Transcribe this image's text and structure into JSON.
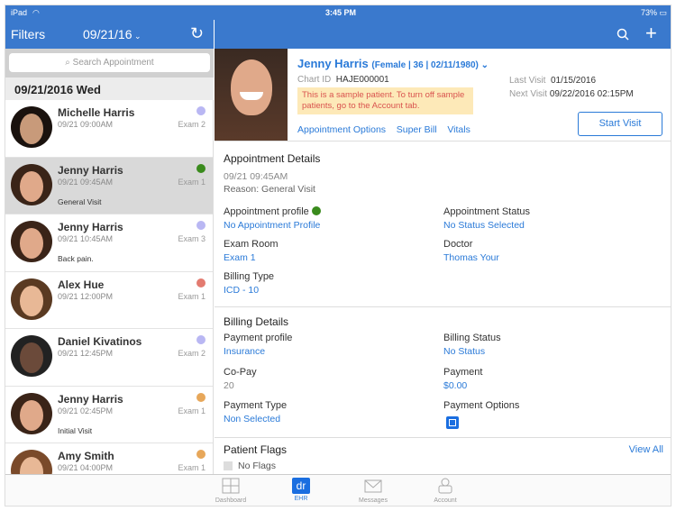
{
  "status": {
    "device": "iPad",
    "time": "3:45 PM",
    "battery": "73%"
  },
  "left_nav": {
    "filters": "Filters",
    "date": "09/21/16",
    "date_icon": "chevron-down-icon",
    "refresh_icon": "refresh-icon"
  },
  "right_nav": {
    "search_icon": "search-icon",
    "add_icon": "plus-icon"
  },
  "search": {
    "placeholder": "Search Appointment"
  },
  "day_header": "09/21/2016 Wed",
  "appointments": [
    {
      "name": "Michelle Harris",
      "time": "09/21 09:00AM",
      "room": "Exam 2",
      "reason": "",
      "color": "#b9b7f3"
    },
    {
      "name": "Jenny Harris",
      "time": "09/21 09:45AM",
      "room": "Exam 1",
      "reason": "General Visit",
      "color": "#3a8b1d",
      "selected": true
    },
    {
      "name": "Jenny Harris",
      "time": "09/21 10:45AM",
      "room": "Exam 3",
      "reason": "Back pain.",
      "color": "#b9b7f3"
    },
    {
      "name": "Alex Hue",
      "time": "09/21 12:00PM",
      "room": "Exam 1",
      "reason": "",
      "color": "#e37b70"
    },
    {
      "name": "Daniel Kivatinos",
      "time": "09/21 12:45PM",
      "room": "Exam 2",
      "reason": "",
      "color": "#b9b7f3"
    },
    {
      "name": "Jenny Harris",
      "time": "09/21 02:45PM",
      "room": "Exam 1",
      "reason": "Initial Visit",
      "color": "#e7a75a"
    },
    {
      "name": "Amy Smith",
      "time": "09/21 04:00PM",
      "room": "Exam 1",
      "reason": "",
      "color": "#e7a75a"
    }
  ],
  "patient": {
    "name": "Jenny Harris",
    "demographics": "(Female | 36 | 02/11/1980)",
    "chart_id_label": "Chart ID",
    "chart_id": "HAJE000001",
    "warning": "This is a sample patient. To turn off sample patients, go to the Account tab.",
    "last_visit_label": "Last Visit",
    "last_visit": "01/15/2016",
    "next_visit_label": "Next Visit",
    "next_visit": "09/22/2016 02:15PM",
    "links": [
      "Appointment Options",
      "Super Bill",
      "Vitals"
    ],
    "start_visit": "Start Visit"
  },
  "appointment_details": {
    "title": "Appointment Details",
    "datetime": "09/21 09:45AM",
    "reason": "Reason: General Visit",
    "profile_label": "Appointment profile",
    "profile_value": "No Appointment Profile",
    "profile_color": "#3a8b1d",
    "status_label": "Appointment Status",
    "status_value": "No Status Selected",
    "room_label": "Exam Room",
    "room_value": "Exam 1",
    "doctor_label": "Doctor",
    "doctor_value": "Thomas Your",
    "billing_type_label": "Billing Type",
    "billing_type_value": "ICD - 10"
  },
  "billing_details": {
    "title": "Billing Details",
    "payment_profile_label": "Payment profile",
    "payment_profile_value": "Insurance",
    "billing_status_label": "Billing Status",
    "billing_status_value": "No Status",
    "copay_label": "Co-Pay",
    "copay_value": "20",
    "payment_label": "Payment",
    "payment_value": "$0.00",
    "payment_type_label": "Payment Type",
    "payment_type_value": "Non Selected",
    "payment_options_label": "Payment Options",
    "payment_options_icon": "square-reader-icon"
  },
  "patient_flags": {
    "title": "Patient Flags",
    "view_all": "View All",
    "value": "No Flags"
  },
  "tabs": [
    {
      "label": "Dashboard"
    },
    {
      "label": "EHR",
      "active": true
    },
    {
      "label": "Messages"
    },
    {
      "label": "Account"
    }
  ],
  "colors": {
    "primary": "#3a79cd",
    "link": "#2a7ad8",
    "warning_bg": "#fde9b8",
    "warning_text": "#d9534f"
  }
}
